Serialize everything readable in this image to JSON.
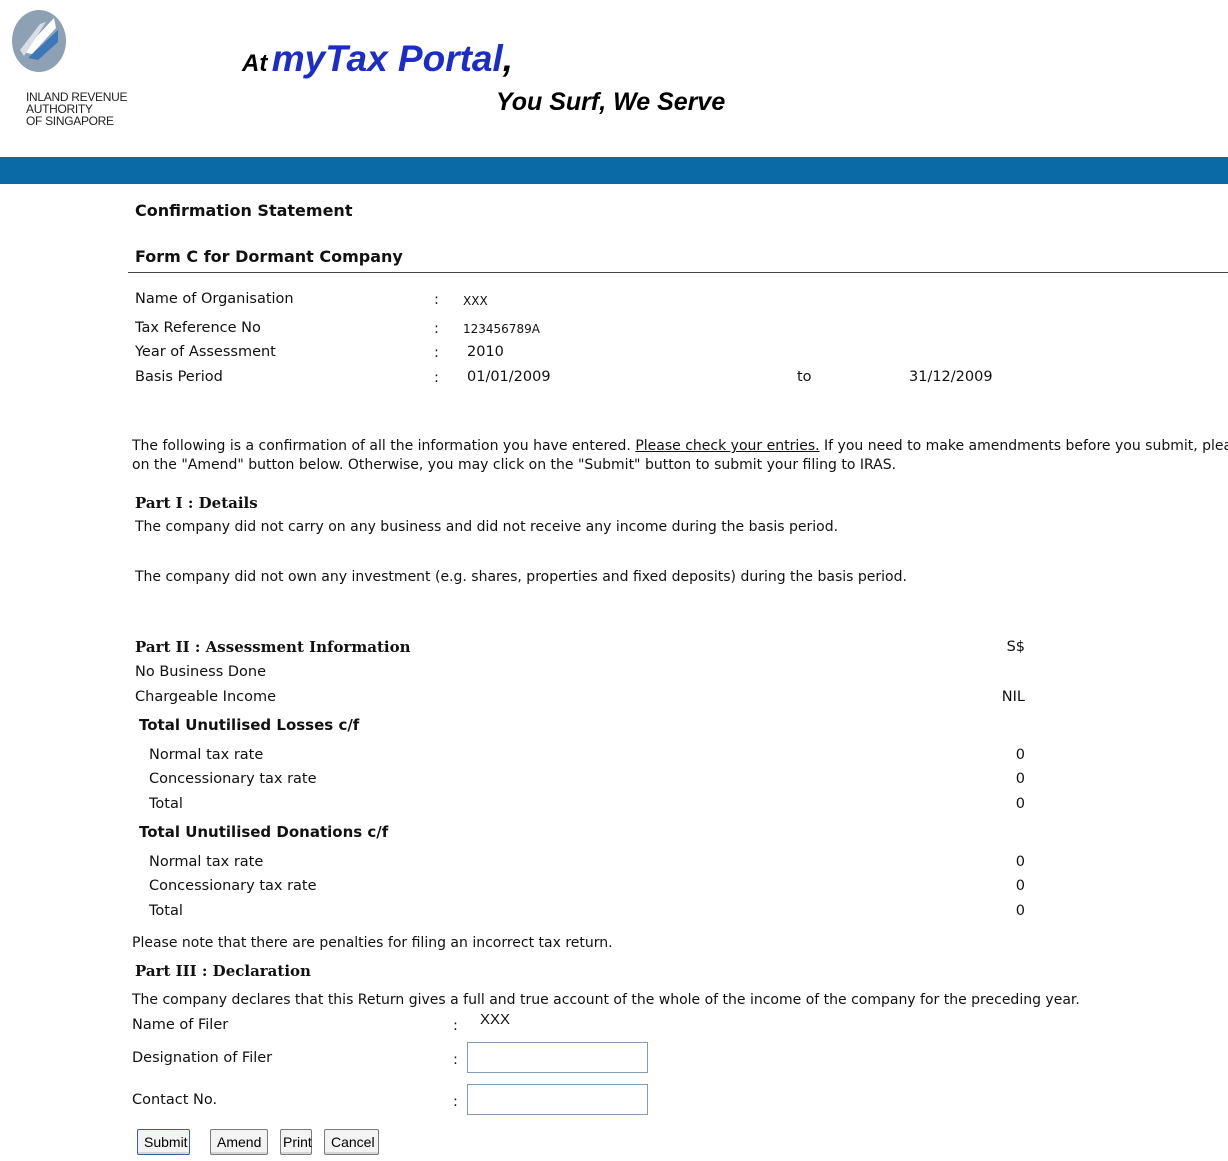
{
  "header": {
    "logo_lines": [
      "INLAND REVENUE",
      "AUTHORITY",
      "OF SINGAPORE"
    ],
    "slogan_prefix": "At",
    "slogan_brand": "myTax Portal",
    "slogan_comma": ",",
    "slogan_tagline": "You Surf, We Serve"
  },
  "page": {
    "title": "Confirmation Statement",
    "form_title": "Form C for Dormant Company"
  },
  "details": {
    "name_label": "Name of Organisation",
    "name_value": "XXX",
    "taxref_label": "Tax Reference No",
    "taxref_value": "123456789A",
    "ya_label": "Year of Assessment",
    "ya_value": "2010",
    "basis_label": "Basis Period",
    "basis_from": "01/01/2009",
    "basis_to_word": "to",
    "basis_to": "31/12/2009",
    "colon": ":"
  },
  "intro": {
    "text1": "The following is a confirmation of all the information you have entered. ",
    "link": "Please check your entries.",
    "text2": " If you need to make amendments before you submit, please click",
    "text3": "on the \"Amend\" button below. Otherwise, you may click on the \"Submit\" button to submit your filing to IRAS."
  },
  "part1": {
    "heading": "Part I : Details",
    "line1": "The company did not carry on any business and did not receive any income during the basis period.",
    "line2": "The company did not own any investment (e.g. shares, properties and fixed deposits) during the basis period."
  },
  "part2": {
    "heading": "Part II : Assessment Information",
    "currency": "S$",
    "no_business": "No Business Done",
    "chargeable_label": "Chargeable Income",
    "chargeable_value": "NIL",
    "losses_heading": "Total Unutilised Losses c/f",
    "losses": [
      {
        "label": "Normal tax rate",
        "value": "0"
      },
      {
        "label": "Concessionary tax rate",
        "value": "0"
      },
      {
        "label": "Total",
        "value": "0"
      }
    ],
    "donations_heading": "Total Unutilised Donations c/f",
    "donations": [
      {
        "label": "Normal tax rate",
        "value": "0"
      },
      {
        "label": "Concessionary tax rate",
        "value": "0"
      },
      {
        "label": "Total",
        "value": "0"
      }
    ],
    "penalty_note": "Please note that there are penalties for filing an incorrect tax return."
  },
  "part3": {
    "heading": "Part III : Declaration",
    "declaration_text": "The company declares that this Return gives a full and true account of the whole of the income of the company for the preceding year.",
    "filer_label": "Name of Filer",
    "filer_value": "XXX",
    "designation_label": "Designation of Filer",
    "designation_value": "",
    "contact_label": "Contact No.",
    "contact_value": ""
  },
  "buttons": {
    "submit": "Submit",
    "amend": "Amend",
    "print": "Print",
    "cancel": "Cancel"
  }
}
